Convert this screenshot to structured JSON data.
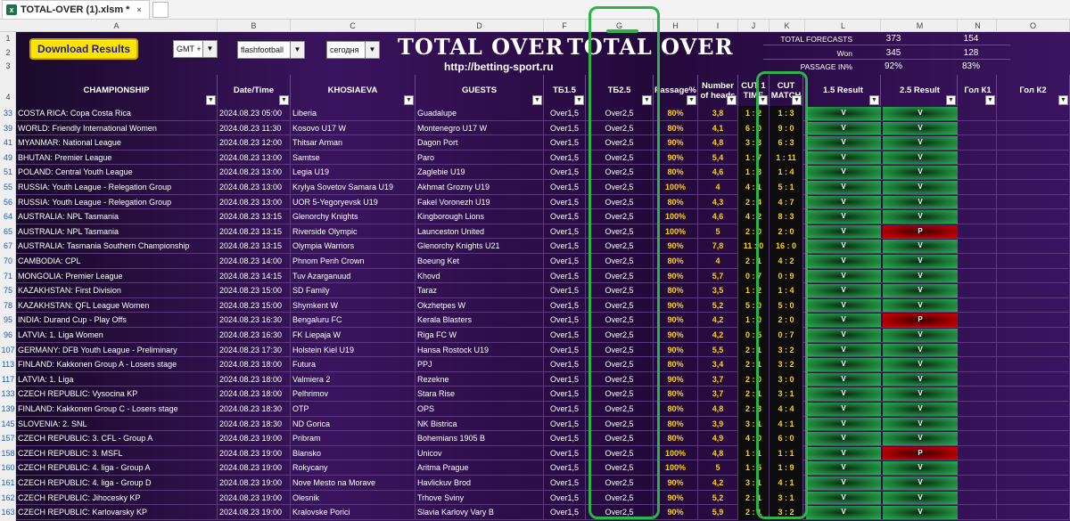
{
  "tab": {
    "icon": "excel-icon",
    "title": "TOTAL-OVER  (1).xlsm *",
    "close": "×"
  },
  "columns": [
    "A",
    "B",
    "C",
    "D",
    "F",
    "G",
    "H",
    "I",
    "J",
    "K",
    "L",
    "M",
    "N",
    "O"
  ],
  "top_rows": [
    "1",
    "2",
    "3",
    "4"
  ],
  "toolbar": {
    "download_label": "Download Results",
    "timezone": "GMT +",
    "source": "flashfootball",
    "day": "сегодня",
    "brand_left": "TOTAL OVER",
    "brand_right": "TOTAL OVER",
    "url": "http://betting-sport.ru"
  },
  "stats": {
    "total_label": "TOTAL FORECASTS",
    "total_15": "373",
    "total_25": "154",
    "won_label": "Won",
    "won_15": "345",
    "won_25": "128",
    "pass_label": "PASSAGE IN%",
    "pass_15": "92%",
    "pass_25": "83%"
  },
  "headers": {
    "championship": "CHAMPIONSHIP",
    "datetime": "Date/Time",
    "home": "KHOSIAEVA",
    "guests": "GUESTS",
    "tb15": "ТБ1.5",
    "tb25": "ТБ2.5",
    "passage": "Passage%",
    "heads": "Number of heads",
    "cut1": "CUT 1 TIME",
    "cutm": "CUT MATCH",
    "r15": "1.5 Result",
    "r25": "2.5 Result",
    "gk1": "Гол К1",
    "gk2": "Гол К2"
  },
  "rows": [
    {
      "n": "33",
      "champ": "COSTA RICA: Copa Costa Rica",
      "dt": "2024.08.23 05:00",
      "home": "Liberia",
      "guest": "Guadalupe",
      "tb15": "Over1,5",
      "tb25": "Over2,5",
      "pct": "80%",
      "heads": "3,8",
      "cut1": "1 : 2",
      "cutm": "1 : 3",
      "r15": "V",
      "r25": "V",
      "r15c": "g",
      "r25c": "g"
    },
    {
      "n": "39",
      "champ": "WORLD: Friendly International Women",
      "dt": "2024.08.23 11:30",
      "home": "Kosovo U17 W",
      "guest": "Montenegro U17 W",
      "tb15": "Over1,5",
      "tb25": "Over2,5",
      "pct": "80%",
      "heads": "4,1",
      "cut1": "6 : 0",
      "cutm": "9 : 0",
      "r15": "V",
      "r25": "V",
      "r15c": "g",
      "r25c": "g"
    },
    {
      "n": "41",
      "champ": "MYANMAR: National League",
      "dt": "2024.08.23 12:00",
      "home": "Thitsar Arman",
      "guest": "Dagon Port",
      "tb15": "Over1,5",
      "tb25": "Over2,5",
      "pct": "90%",
      "heads": "4,8",
      "cut1": "3 : 3",
      "cutm": "6 : 3",
      "r15": "V",
      "r25": "V",
      "r15c": "g",
      "r25c": "g"
    },
    {
      "n": "49",
      "champ": "BHUTAN: Premier League",
      "dt": "2024.08.23 13:00",
      "home": "Samtse",
      "guest": "Paro",
      "tb15": "Over1,5",
      "tb25": "Over2,5",
      "pct": "90%",
      "heads": "5,4",
      "cut1": "1 : 7",
      "cutm": "1 : 11",
      "r15": "V",
      "r25": "V",
      "r15c": "g",
      "r25c": "g"
    },
    {
      "n": "51",
      "champ": "POLAND: Central Youth League",
      "dt": "2024.08.23 13:00",
      "home": "Legia U19",
      "guest": "Zaglebie U19",
      "tb15": "Over1,5",
      "tb25": "Over2,5",
      "pct": "80%",
      "heads": "4,6",
      "cut1": "1 : 3",
      "cutm": "1 : 4",
      "r15": "V",
      "r25": "V",
      "r15c": "g",
      "r25c": "g"
    },
    {
      "n": "55",
      "champ": "RUSSIA: Youth League - Relegation Group",
      "dt": "2024.08.23 13:00",
      "home": "Krylya Sovetov Samara U19",
      "guest": "Akhmat Grozny U19",
      "tb15": "Over1,5",
      "tb25": "Over2,5",
      "pct": "100%",
      "heads": "4",
      "cut1": "4 : 1",
      "cutm": "5 : 1",
      "r15": "V",
      "r25": "V",
      "r15c": "g",
      "r25c": "g"
    },
    {
      "n": "56",
      "champ": "RUSSIA: Youth League - Relegation Group",
      "dt": "2024.08.23 13:00",
      "home": "UOR 5-Yegoryevsk U19",
      "guest": "Fakel Voronezh U19",
      "tb15": "Over1,5",
      "tb25": "Over2,5",
      "pct": "80%",
      "heads": "4,3",
      "cut1": "2 : 4",
      "cutm": "4 : 7",
      "r15": "V",
      "r25": "V",
      "r15c": "g",
      "r25c": "g"
    },
    {
      "n": "64",
      "champ": "AUSTRALIA: NPL Tasmania",
      "dt": "2024.08.23 13:15",
      "home": "Glenorchy Knights",
      "guest": "Kingborough Lions",
      "tb15": "Over1,5",
      "tb25": "Over2,5",
      "pct": "100%",
      "heads": "4,6",
      "cut1": "4 : 2",
      "cutm": "8 : 3",
      "r15": "V",
      "r25": "V",
      "r15c": "g",
      "r25c": "g"
    },
    {
      "n": "65",
      "champ": "AUSTRALIA: NPL Tasmania",
      "dt": "2024.08.23 13:15",
      "home": "Riverside Olympic",
      "guest": "Launceston United",
      "tb15": "Over1,5",
      "tb25": "Over2,5",
      "pct": "100%",
      "heads": "5",
      "cut1": "2 : 0",
      "cutm": "2 : 0",
      "r15": "V",
      "r25": "P",
      "r15c": "g",
      "r25c": "r"
    },
    {
      "n": "67",
      "champ": "AUSTRALIA: Tasmania Southern Championship",
      "dt": "2024.08.23 13:15",
      "home": "Olympia Warriors",
      "guest": "Glenorchy Knights U21",
      "tb15": "Over1,5",
      "tb25": "Over2,5",
      "pct": "90%",
      "heads": "7,8",
      "cut1": "11 : 0",
      "cutm": "16 : 0",
      "r15": "V",
      "r25": "V",
      "r15c": "g",
      "r25c": "g"
    },
    {
      "n": "70",
      "champ": "CAMBODIA: CPL",
      "dt": "2024.08.23 14:00",
      "home": "Phnom Penh Crown",
      "guest": "Boeung Ket",
      "tb15": "Over1,5",
      "tb25": "Over2,5",
      "pct": "80%",
      "heads": "4",
      "cut1": "2 : 1",
      "cutm": "4 : 2",
      "r15": "V",
      "r25": "V",
      "r15c": "g",
      "r25c": "g"
    },
    {
      "n": "71",
      "champ": "MONGOLIA: Premier League",
      "dt": "2024.08.23 14:15",
      "home": "Tuv Azarganuud",
      "guest": "Khovd",
      "tb15": "Over1,5",
      "tb25": "Over2,5",
      "pct": "90%",
      "heads": "5,7",
      "cut1": "0 : 7",
      "cutm": "0 : 9",
      "r15": "V",
      "r25": "V",
      "r15c": "g",
      "r25c": "g"
    },
    {
      "n": "75",
      "champ": "KAZAKHSTAN: First Division",
      "dt": "2024.08.23 15:00",
      "home": "SD Family",
      "guest": "Taraz",
      "tb15": "Over1,5",
      "tb25": "Over2,5",
      "pct": "80%",
      "heads": "3,5",
      "cut1": "1 : 2",
      "cutm": "1 : 4",
      "r15": "V",
      "r25": "V",
      "r15c": "g",
      "r25c": "g"
    },
    {
      "n": "78",
      "champ": "KAZAKHSTAN: QFL League Women",
      "dt": "2024.08.23 15:00",
      "home": "Shymkent W",
      "guest": "Okzhetpes W",
      "tb15": "Over1,5",
      "tb25": "Over2,5",
      "pct": "90%",
      "heads": "5,2",
      "cut1": "5 : 0",
      "cutm": "5 : 0",
      "r15": "V",
      "r25": "V",
      "r15c": "g",
      "r25c": "g"
    },
    {
      "n": "95",
      "champ": "INDIA: Durand Cup - Play Offs",
      "dt": "2024.08.23 16:30",
      "home": "Bengaluru FC",
      "guest": "Kerala Blasters",
      "tb15": "Over1,5",
      "tb25": "Over2,5",
      "pct": "90%",
      "heads": "4,2",
      "cut1": "1 : 0",
      "cutm": "2 : 0",
      "r15": "V",
      "r25": "P",
      "r15c": "g",
      "r25c": "r"
    },
    {
      "n": "96",
      "champ": "LATVIA: 1. Liga Women",
      "dt": "2024.08.23 16:30",
      "home": "FK Liepaja W",
      "guest": "Riga FC W",
      "tb15": "Over1,5",
      "tb25": "Over2,5",
      "pct": "90%",
      "heads": "4,2",
      "cut1": "0 : 5",
      "cutm": "0 : 7",
      "r15": "V",
      "r25": "V",
      "r15c": "g",
      "r25c": "g"
    },
    {
      "n": "107",
      "champ": "GERMANY: DFB Youth League - Preliminary",
      "dt": "2024.08.23 17:30",
      "home": "Holstein Kiel U19",
      "guest": "Hansa Rostock U19",
      "tb15": "Over1,5",
      "tb25": "Over2,5",
      "pct": "90%",
      "heads": "5,5",
      "cut1": "2 : 1",
      "cutm": "3 : 2",
      "r15": "V",
      "r25": "V",
      "r15c": "g",
      "r25c": "g"
    },
    {
      "n": "113",
      "champ": "FINLAND: Kakkonen Group A - Losers stage",
      "dt": "2024.08.23 18:00",
      "home": "Futura",
      "guest": "PPJ",
      "tb15": "Over1,5",
      "tb25": "Over2,5",
      "pct": "80%",
      "heads": "3,4",
      "cut1": "2 : 1",
      "cutm": "3 : 2",
      "r15": "V",
      "r25": "V",
      "r15c": "g",
      "r25c": "g"
    },
    {
      "n": "117",
      "champ": "LATVIA: 1. Liga",
      "dt": "2024.08.23 18:00",
      "home": "Valmiera 2",
      "guest": "Rezekne",
      "tb15": "Over1,5",
      "tb25": "Over2,5",
      "pct": "90%",
      "heads": "3,7",
      "cut1": "2 : 0",
      "cutm": "3 : 0",
      "r15": "V",
      "r25": "V",
      "r15c": "g",
      "r25c": "g"
    },
    {
      "n": "133",
      "champ": "CZECH REPUBLIC: Vysocina KP",
      "dt": "2024.08.23 18:00",
      "home": "Pelhrimov",
      "guest": "Stara Rise",
      "tb15": "Over1,5",
      "tb25": "Over2,5",
      "pct": "80%",
      "heads": "3,7",
      "cut1": "2 : 1",
      "cutm": "3 : 1",
      "r15": "V",
      "r25": "V",
      "r15c": "g",
      "r25c": "g"
    },
    {
      "n": "139",
      "champ": "FINLAND: Kakkonen Group C - Losers stage",
      "dt": "2024.08.23 18:30",
      "home": "OTP",
      "guest": "OPS",
      "tb15": "Over1,5",
      "tb25": "Over2,5",
      "pct": "80%",
      "heads": "4,8",
      "cut1": "2 : 3",
      "cutm": "4 : 4",
      "r15": "V",
      "r25": "V",
      "r15c": "g",
      "r25c": "g"
    },
    {
      "n": "145",
      "champ": "SLOVENIA: 2. SNL",
      "dt": "2024.08.23 18:30",
      "home": "ND Gorica",
      "guest": "NK Bistrica",
      "tb15": "Over1,5",
      "tb25": "Over2,5",
      "pct": "80%",
      "heads": "3,9",
      "cut1": "3 : 1",
      "cutm": "4 : 1",
      "r15": "V",
      "r25": "V",
      "r15c": "g",
      "r25c": "g"
    },
    {
      "n": "157",
      "champ": "CZECH REPUBLIC: 3. CFL - Group A",
      "dt": "2024.08.23 19:00",
      "home": "Pribram",
      "guest": "Bohemians 1905 B",
      "tb15": "Over1,5",
      "tb25": "Over2,5",
      "pct": "80%",
      "heads": "4,9",
      "cut1": "4 : 0",
      "cutm": "6 : 0",
      "r15": "V",
      "r25": "V",
      "r15c": "g",
      "r25c": "g"
    },
    {
      "n": "158",
      "champ": "CZECH REPUBLIC: 3. MSFL",
      "dt": "2024.08.23 19:00",
      "home": "Blansko",
      "guest": "Unicov",
      "tb15": "Over1,5",
      "tb25": "Over2,5",
      "pct": "100%",
      "heads": "4,8",
      "cut1": "1 : 1",
      "cutm": "1 : 1",
      "r15": "V",
      "r25": "P",
      "r15c": "g",
      "r25c": "r"
    },
    {
      "n": "160",
      "champ": "CZECH REPUBLIC: 4. liga - Group A",
      "dt": "2024.08.23 19:00",
      "home": "Rokycany",
      "guest": "Aritma Prague",
      "tb15": "Over1,5",
      "tb25": "Over2,5",
      "pct": "100%",
      "heads": "5",
      "cut1": "1 : 5",
      "cutm": "1 : 9",
      "r15": "V",
      "r25": "V",
      "r15c": "g",
      "r25c": "g"
    },
    {
      "n": "161",
      "champ": "CZECH REPUBLIC: 4. liga - Group D",
      "dt": "2024.08.23 19:00",
      "home": "Nove Mesto na Morave",
      "guest": "Havlickuv Brod",
      "tb15": "Over1,5",
      "tb25": "Over2,5",
      "pct": "90%",
      "heads": "4,2",
      "cut1": "3 : 1",
      "cutm": "4 : 1",
      "r15": "V",
      "r25": "V",
      "r15c": "g",
      "r25c": "g"
    },
    {
      "n": "162",
      "champ": "CZECH REPUBLIC: Jihocesky KP",
      "dt": "2024.08.23 19:00",
      "home": "Olesnik",
      "guest": "Trhove Sviny",
      "tb15": "Over1,5",
      "tb25": "Over2,5",
      "pct": "90%",
      "heads": "5,2",
      "cut1": "2 : 1",
      "cutm": "3 : 1",
      "r15": "V",
      "r25": "V",
      "r15c": "g",
      "r25c": "g"
    },
    {
      "n": "163",
      "champ": "CZECH REPUBLIC: Karlovarsky KP",
      "dt": "2024.08.23 19:00",
      "home": "Kralovske Porici",
      "guest": "Slavia Karlovy Vary B",
      "tb15": "Over1,5",
      "tb25": "Over2,5",
      "pct": "90%",
      "heads": "5,9",
      "cut1": "2 : 1",
      "cutm": "3 : 2",
      "r15": "V",
      "r25": "V",
      "r15c": "g",
      "r25c": "g"
    }
  ]
}
